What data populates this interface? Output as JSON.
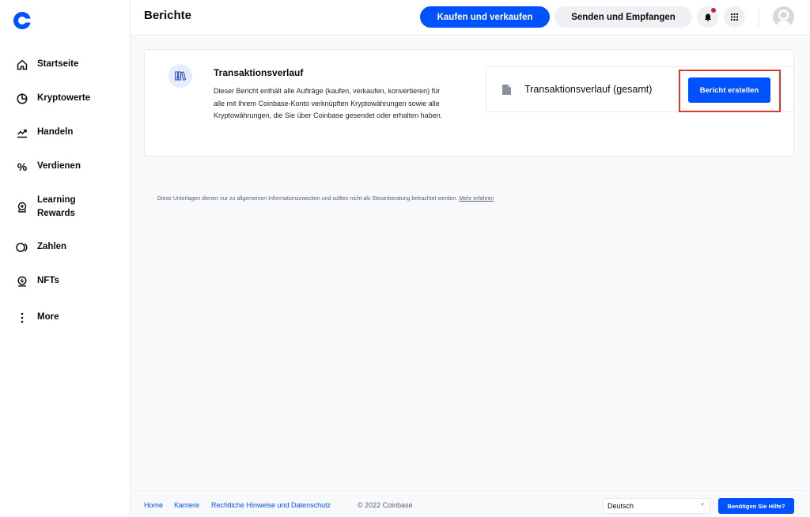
{
  "app": {
    "brand_color": "#0052ff"
  },
  "sidebar": {
    "items": [
      {
        "label": "Startseite",
        "icon": "home-icon"
      },
      {
        "label": "Kryptowerte",
        "icon": "pie-chart-icon"
      },
      {
        "label": "Handeln",
        "icon": "trending-icon"
      },
      {
        "label": "Verdienen",
        "icon": "percent-icon"
      },
      {
        "label": "Learning Rewards",
        "icon": "learning-rewards-icon"
      },
      {
        "label": "Zahlen",
        "icon": "pay-icon"
      },
      {
        "label": "NFTs",
        "icon": "nft-icon"
      },
      {
        "label": "More",
        "icon": "more-vertical-icon"
      }
    ]
  },
  "header": {
    "title": "Berichte",
    "buy_sell_label": "Kaufen und verkaufen",
    "send_receive_label": "Senden und Empfangen",
    "notification_dot": true
  },
  "report_card": {
    "title": "Transaktionsverlauf",
    "description": "Dieser Bericht enthält alle Aufträge (kaufen, verkaufen, konvertieren) für alle mit Ihrem Coinbase-Konto verknüpften Kryptowährungen sowie alle Kryptowährungen, die Sie über Coinbase gesendet oder erhalten haben.",
    "report_name": "Transaktionsverlauf (gesamt)",
    "create_button_label": "Bericht erstellen"
  },
  "disclaimer": {
    "text": "Diese Unterlagen dienen nur zu allgemeinen Informationszwecken und sollten nicht als Steuerberatung betrachtet werden.",
    "link_label": "Mehr erfahren"
  },
  "footer": {
    "links": [
      "Home",
      "Karriere",
      "Rechtliche Hinweise und Datenschutz"
    ],
    "copyright": "© 2022 Coinbase",
    "language_selected": "Deutsch",
    "help_button_label": "Benötigen Sie Hilfe?"
  }
}
